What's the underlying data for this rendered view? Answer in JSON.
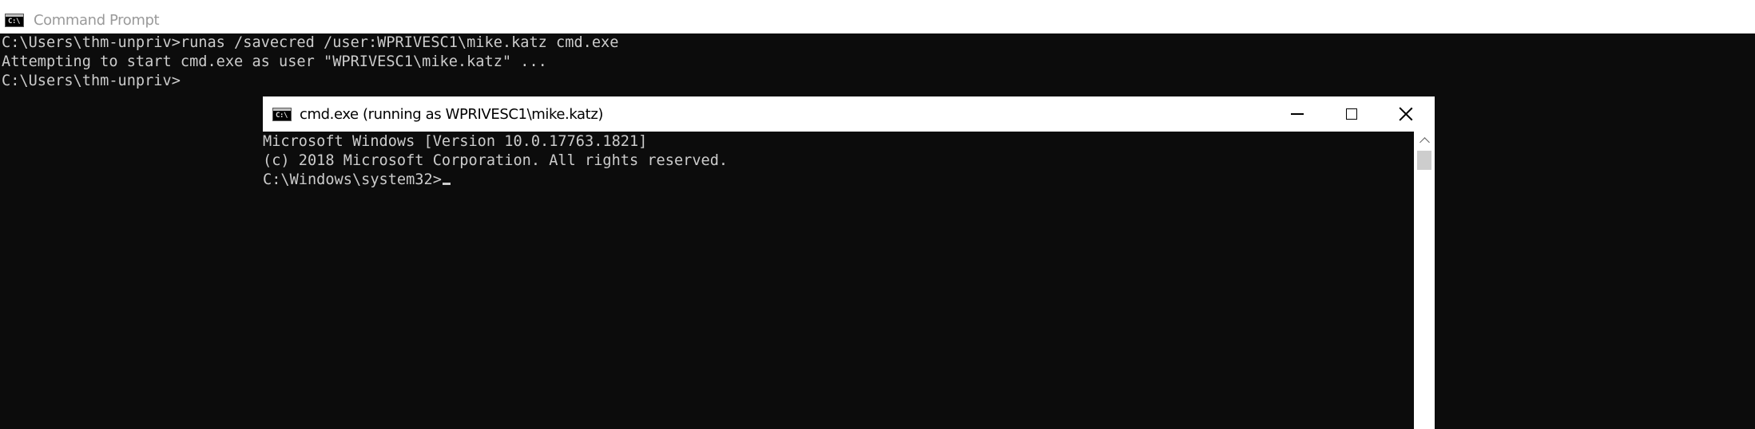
{
  "background_window": {
    "title": "Command Prompt",
    "icon": "cmd-icon",
    "icon_text": "C:\\",
    "lines": [
      "C:\\Users\\thm-unpriv>runas /savecred /user:WPRIVESC1\\mike.katz cmd.exe",
      "Attempting to start cmd.exe as user \"WPRIVESC1\\mike.katz\" ...",
      "",
      "C:\\Users\\thm-unpriv>"
    ]
  },
  "foreground_window": {
    "title": "cmd.exe (running as WPRIVESC1\\mike.katz)",
    "icon": "cmd-icon",
    "icon_text": "C:\\",
    "controls": {
      "minimize_icon": "minimize-icon",
      "maximize_icon": "maximize-icon",
      "close_icon": "close-icon"
    },
    "lines": [
      "Microsoft Windows [Version 10.0.17763.1821]",
      "(c) 2018 Microsoft Corporation. All rights reserved.",
      ""
    ],
    "prompt": "C:\\Windows\\system32>",
    "scrollbar": {
      "up_icon": "scroll-up-arrow-icon"
    }
  },
  "colors": {
    "console_background": "#0c0c0c",
    "console_text": "#cccccc",
    "title_bar": "#ffffff",
    "inactive_title_text": "#9a9a9a"
  }
}
